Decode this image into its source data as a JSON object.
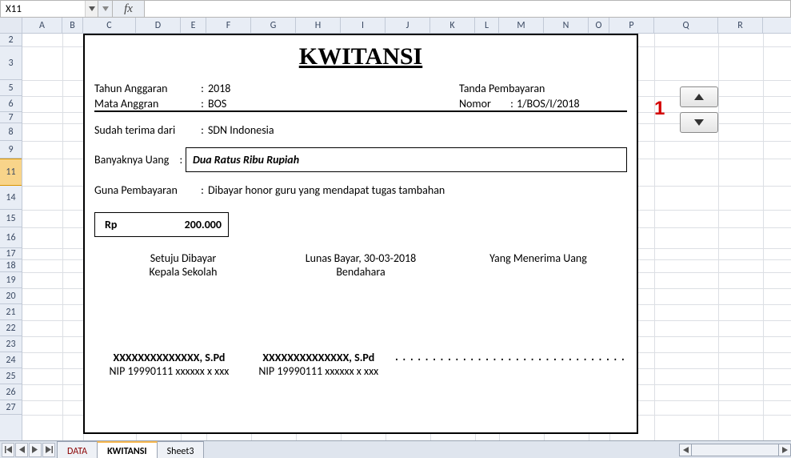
{
  "formula_bar": {
    "name_box": "X11",
    "fx_label": "fx",
    "formula": ""
  },
  "columns": [
    "A",
    "B",
    "C",
    "D",
    "E",
    "F",
    "G",
    "H",
    "I",
    "J",
    "K",
    "L",
    "M",
    "N",
    "O",
    "P",
    "Q",
    "R"
  ],
  "row_headers": [
    2,
    3,
    5,
    6,
    7,
    8,
    9,
    11,
    14,
    15,
    16,
    17,
    18,
    19,
    20,
    21,
    22,
    23,
    24,
    25,
    26,
    27
  ],
  "receipt": {
    "title": "KWITANSI",
    "tahun_label": "Tahun Anggaran",
    "tahun_val": "2018",
    "tanda_label": "Tanda Pembayaran",
    "mata_label": "Mata Anggran",
    "mata_val": "BOS",
    "nomor_label": "Nomor",
    "nomor_val": "1/BOS/I/2018",
    "sudah_label": "Sudah terima dari",
    "sudah_val": "SDN Indonesia",
    "banyak_label": "Banyaknya Uang",
    "banyak_val": "Dua Ratus Ribu Rupiah",
    "guna_label": "Guna Pembayaran",
    "guna_val": "Dibayar honor guru yang mendapat tugas tambahan",
    "rp_label": "Rp",
    "rp_val": "200.000",
    "setuju1": "Setuju Dibayar",
    "setuju2": "Kepala Sekolah",
    "lunas": "Lunas Bayar, 30-03-2018",
    "bendahara": "Bendahara",
    "menerima": "Yang Menerima Uang",
    "sig_l_name": "XXXXXXXXXXXXXX, S.Pd",
    "sig_l_nip": "NIP 19990111 xxxxxx x xxx",
    "sig_m_name": "XXXXXXXXXXXXXX, S.Pd",
    "sig_m_nip": "NIP 19990111 xxxxxx x xxx",
    "sig_r_dots": "..............................."
  },
  "spinner_number": "1",
  "tabs": {
    "t1": "DATA",
    "t2": "KWITANSI",
    "t3": "Sheet3"
  },
  "icons": {
    "chev_down": "▾",
    "tri_up": "▲",
    "tri_down": "▼",
    "first": "⏮",
    "prev": "◀",
    "next": "▶",
    "last": "⏭"
  }
}
